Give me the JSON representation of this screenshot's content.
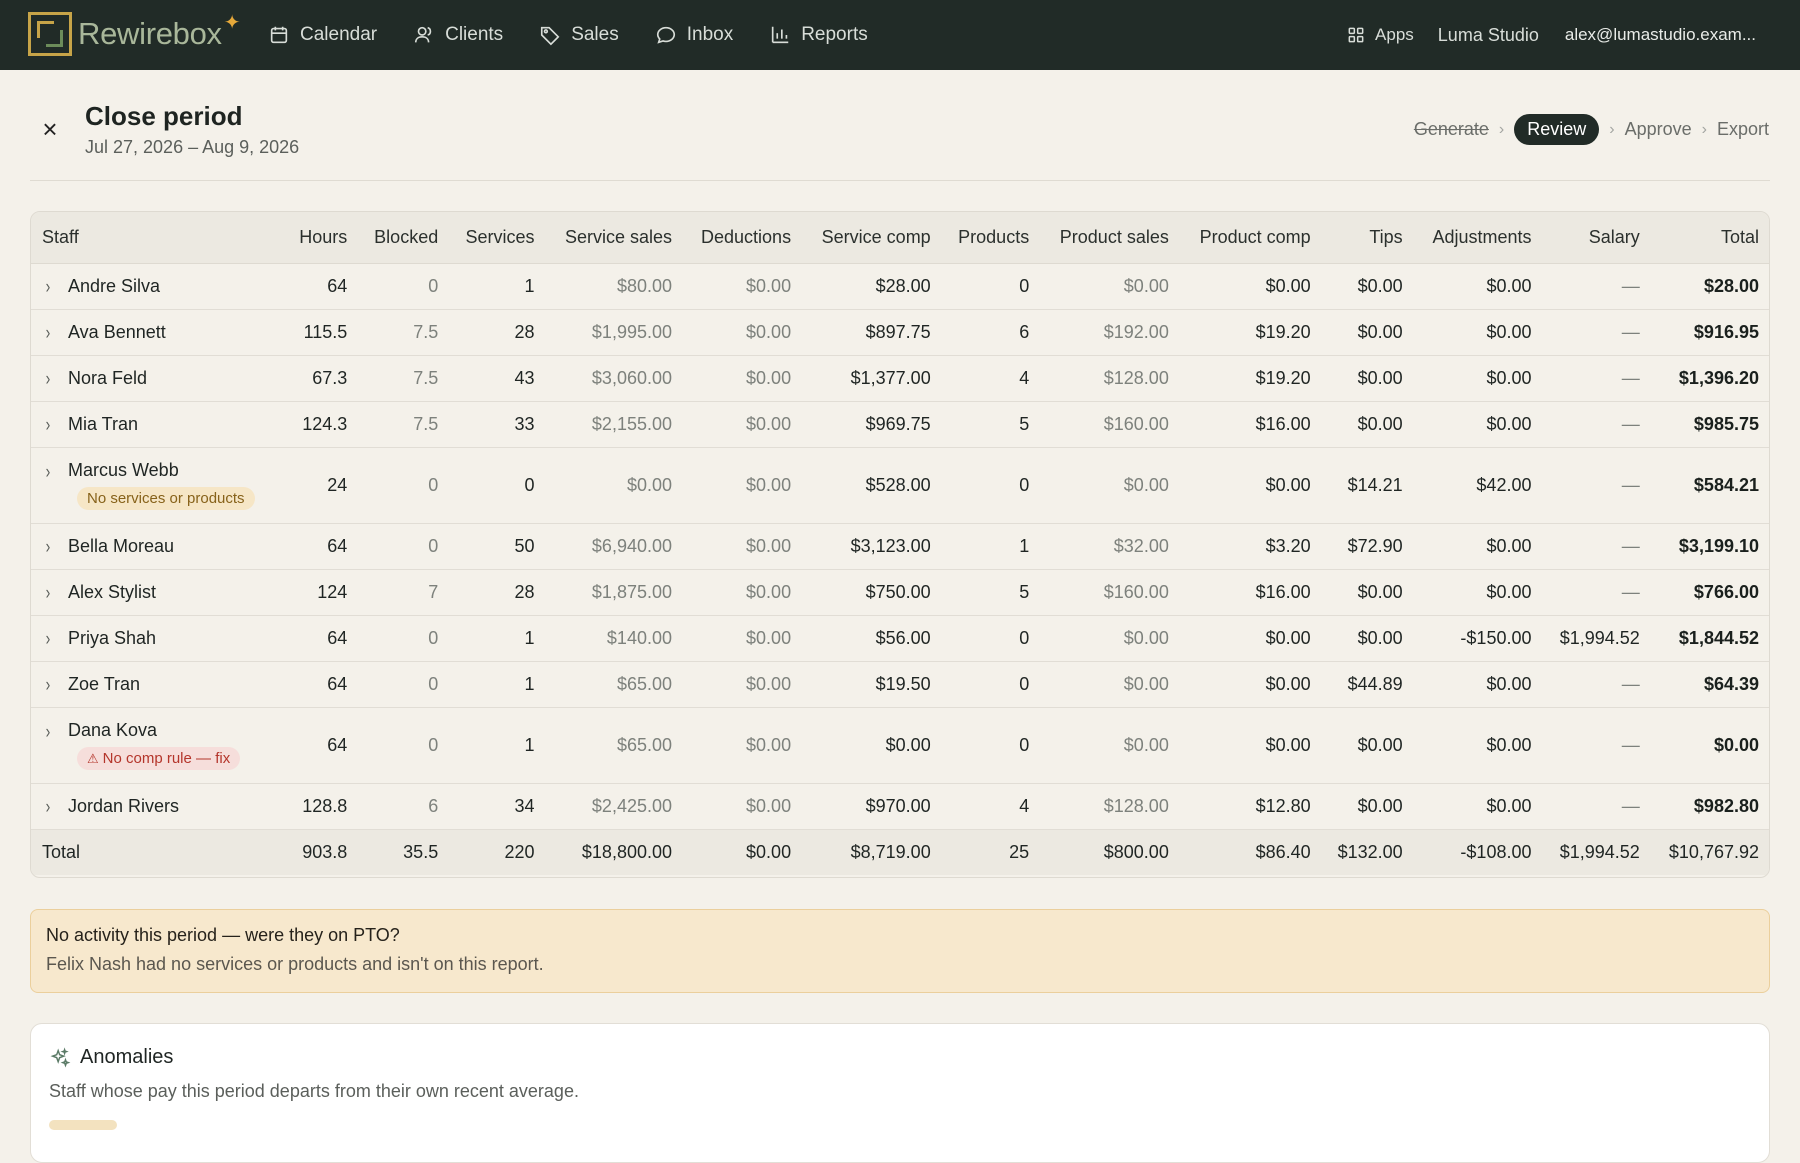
{
  "app": {
    "brand": "Rewirebox",
    "nav": [
      {
        "label": "Calendar",
        "icon": "calendar-icon"
      },
      {
        "label": "Clients",
        "icon": "users-icon"
      },
      {
        "label": "Sales",
        "icon": "tag-icon"
      },
      {
        "label": "Inbox",
        "icon": "chat-bubble-icon"
      },
      {
        "label": "Reports",
        "icon": "bar-chart-icon"
      }
    ],
    "apps_label": "Apps",
    "studio": "Luma Studio",
    "account": "alex@lumastudio.exam..."
  },
  "header": {
    "title": "Close period",
    "subtitle": "Jul 27, 2026 – Aug 9, 2026",
    "steps": [
      "Generate",
      "Review",
      "Approve",
      "Export"
    ],
    "active_step": "Review"
  },
  "table": {
    "columns": [
      "Staff",
      "Hours",
      "Blocked",
      "Services",
      "Service sales",
      "Deductions",
      "Service comp",
      "Products",
      "Product sales",
      "Product comp",
      "Tips",
      "Adjustments",
      "Salary",
      "Total"
    ],
    "rows": [
      {
        "name": "Andre Silva",
        "tag": "",
        "tag_type": "",
        "hours": "64",
        "blocked": "0",
        "services": "1",
        "service_sales": "$80.00",
        "deductions": "$0.00",
        "service_comp": "$28.00",
        "products": "0",
        "product_sales": "$0.00",
        "product_comp": "$0.00",
        "tips": "$0.00",
        "adjustments": "$0.00",
        "salary": "—",
        "total": "$28.00"
      },
      {
        "name": "Ava Bennett",
        "tag": "",
        "tag_type": "",
        "hours": "115.5",
        "blocked": "7.5",
        "services": "28",
        "service_sales": "$1,995.00",
        "deductions": "$0.00",
        "service_comp": "$897.75",
        "products": "6",
        "product_sales": "$192.00",
        "product_comp": "$19.20",
        "tips": "$0.00",
        "adjustments": "$0.00",
        "salary": "—",
        "total": "$916.95"
      },
      {
        "name": "Nora Feld",
        "tag": "",
        "tag_type": "",
        "hours": "67.3",
        "blocked": "7.5",
        "services": "43",
        "service_sales": "$3,060.00",
        "deductions": "$0.00",
        "service_comp": "$1,377.00",
        "products": "4",
        "product_sales": "$128.00",
        "product_comp": "$19.20",
        "tips": "$0.00",
        "adjustments": "$0.00",
        "salary": "—",
        "total": "$1,396.20"
      },
      {
        "name": "Mia Tran",
        "tag": "",
        "tag_type": "",
        "hours": "124.3",
        "blocked": "7.5",
        "services": "33",
        "service_sales": "$2,155.00",
        "deductions": "$0.00",
        "service_comp": "$969.75",
        "products": "5",
        "product_sales": "$160.00",
        "product_comp": "$16.00",
        "tips": "$0.00",
        "adjustments": "$0.00",
        "salary": "—",
        "total": "$985.75"
      },
      {
        "name": "Marcus Webb",
        "tag": "No services or products",
        "tag_type": "warn",
        "hours": "24",
        "blocked": "0",
        "services": "0",
        "service_sales": "$0.00",
        "deductions": "$0.00",
        "service_comp": "$528.00",
        "products": "0",
        "product_sales": "$0.00",
        "product_comp": "$0.00",
        "tips": "$14.21",
        "adjustments": "$42.00",
        "salary": "—",
        "total": "$584.21"
      },
      {
        "name": "Bella Moreau",
        "tag": "",
        "tag_type": "",
        "hours": "64",
        "blocked": "0",
        "services": "50",
        "service_sales": "$6,940.00",
        "deductions": "$0.00",
        "service_comp": "$3,123.00",
        "products": "1",
        "product_sales": "$32.00",
        "product_comp": "$3.20",
        "tips": "$72.90",
        "adjustments": "$0.00",
        "salary": "—",
        "total": "$3,199.10"
      },
      {
        "name": "Alex Stylist",
        "tag": "",
        "tag_type": "",
        "hours": "124",
        "blocked": "7",
        "services": "28",
        "service_sales": "$1,875.00",
        "deductions": "$0.00",
        "service_comp": "$750.00",
        "products": "5",
        "product_sales": "$160.00",
        "product_comp": "$16.00",
        "tips": "$0.00",
        "adjustments": "$0.00",
        "salary": "—",
        "total": "$766.00"
      },
      {
        "name": "Priya Shah",
        "tag": "",
        "tag_type": "",
        "hours": "64",
        "blocked": "0",
        "services": "1",
        "service_sales": "$140.00",
        "deductions": "$0.00",
        "service_comp": "$56.00",
        "products": "0",
        "product_sales": "$0.00",
        "product_comp": "$0.00",
        "tips": "$0.00",
        "adjustments": "-$150.00",
        "salary": "$1,994.52",
        "total": "$1,844.52"
      },
      {
        "name": "Zoe Tran",
        "tag": "",
        "tag_type": "",
        "hours": "64",
        "blocked": "0",
        "services": "1",
        "service_sales": "$65.00",
        "deductions": "$0.00",
        "service_comp": "$19.50",
        "products": "0",
        "product_sales": "$0.00",
        "product_comp": "$0.00",
        "tips": "$44.89",
        "adjustments": "$0.00",
        "salary": "—",
        "total": "$64.39"
      },
      {
        "name": "Dana Kova",
        "tag": "No comp rule — fix",
        "tag_type": "err",
        "hours": "64",
        "blocked": "0",
        "services": "1",
        "service_sales": "$65.00",
        "deductions": "$0.00",
        "service_comp": "$0.00",
        "products": "0",
        "product_sales": "$0.00",
        "product_comp": "$0.00",
        "tips": "$0.00",
        "adjustments": "$0.00",
        "salary": "—",
        "total": "$0.00"
      },
      {
        "name": "Jordan Rivers",
        "tag": "",
        "tag_type": "",
        "hours": "128.8",
        "blocked": "6",
        "services": "34",
        "service_sales": "$2,425.00",
        "deductions": "$0.00",
        "service_comp": "$970.00",
        "products": "4",
        "product_sales": "$128.00",
        "product_comp": "$12.80",
        "tips": "$0.00",
        "adjustments": "$0.00",
        "salary": "—",
        "total": "$982.80"
      }
    ],
    "totals": {
      "label": "Total",
      "hours": "903.8",
      "blocked": "35.5",
      "services": "220",
      "service_sales": "$18,800.00",
      "deductions": "$0.00",
      "service_comp": "$8,719.00",
      "products": "25",
      "product_sales": "$800.00",
      "product_comp": "$86.40",
      "tips": "$132.00",
      "adjustments": "-$108.00",
      "salary": "$1,994.52",
      "total": "$10,767.92"
    }
  },
  "notice": {
    "title": "No activity this period — were they on PTO?",
    "body": "Felix Nash had no services or products and isn't on this report."
  },
  "anomalies": {
    "title": "Anomalies",
    "subtitle": "Staff whose pay this period departs from their own recent average."
  },
  "colors": {
    "topbar": "#212b27",
    "accent_gold": "#c7a448",
    "warn_bg": "#f7e8cd",
    "error_text": "#b4352b"
  }
}
